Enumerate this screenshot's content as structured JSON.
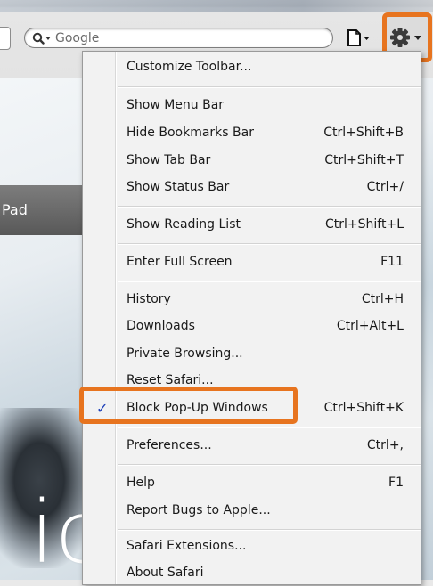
{
  "toolbar": {
    "search_placeholder": "Google",
    "icons": [
      "search-icon",
      "page-menu-icon",
      "gear-icon"
    ]
  },
  "page": {
    "nav_text": "Pad",
    "big_text": "ic"
  },
  "menu": {
    "items": [
      {
        "label": "Customize Toolbar...",
        "shortcut": "",
        "checked": false
      },
      {
        "label": "Show Menu Bar",
        "shortcut": "",
        "checked": false
      },
      {
        "label": "Hide Bookmarks Bar",
        "shortcut": "Ctrl+Shift+B",
        "checked": false
      },
      {
        "label": "Show Tab Bar",
        "shortcut": "Ctrl+Shift+T",
        "checked": false
      },
      {
        "label": "Show Status Bar",
        "shortcut": "Ctrl+/",
        "checked": false
      },
      {
        "label": "Show Reading List",
        "shortcut": "Ctrl+Shift+L",
        "checked": false
      },
      {
        "label": "Enter Full Screen",
        "shortcut": "F11",
        "checked": false
      },
      {
        "label": "History",
        "shortcut": "Ctrl+H",
        "checked": false
      },
      {
        "label": "Downloads",
        "shortcut": "Ctrl+Alt+L",
        "checked": false
      },
      {
        "label": "Private Browsing...",
        "shortcut": "",
        "checked": false
      },
      {
        "label": "Reset Safari...",
        "shortcut": "",
        "checked": false
      },
      {
        "label": "Block Pop-Up Windows",
        "shortcut": "Ctrl+Shift+K",
        "checked": true,
        "check_mark": "✓"
      },
      {
        "label": "Preferences...",
        "shortcut": "Ctrl+,",
        "checked": false
      },
      {
        "label": "Help",
        "shortcut": "F1",
        "checked": false
      },
      {
        "label": "Report Bugs to Apple...",
        "shortcut": "",
        "checked": false
      },
      {
        "label": "Safari Extensions...",
        "shortcut": "",
        "checked": false
      },
      {
        "label": "About Safari",
        "shortcut": "",
        "checked": false
      }
    ]
  },
  "colors": {
    "highlight": "#e7741f",
    "check": "#1d3fb8"
  }
}
